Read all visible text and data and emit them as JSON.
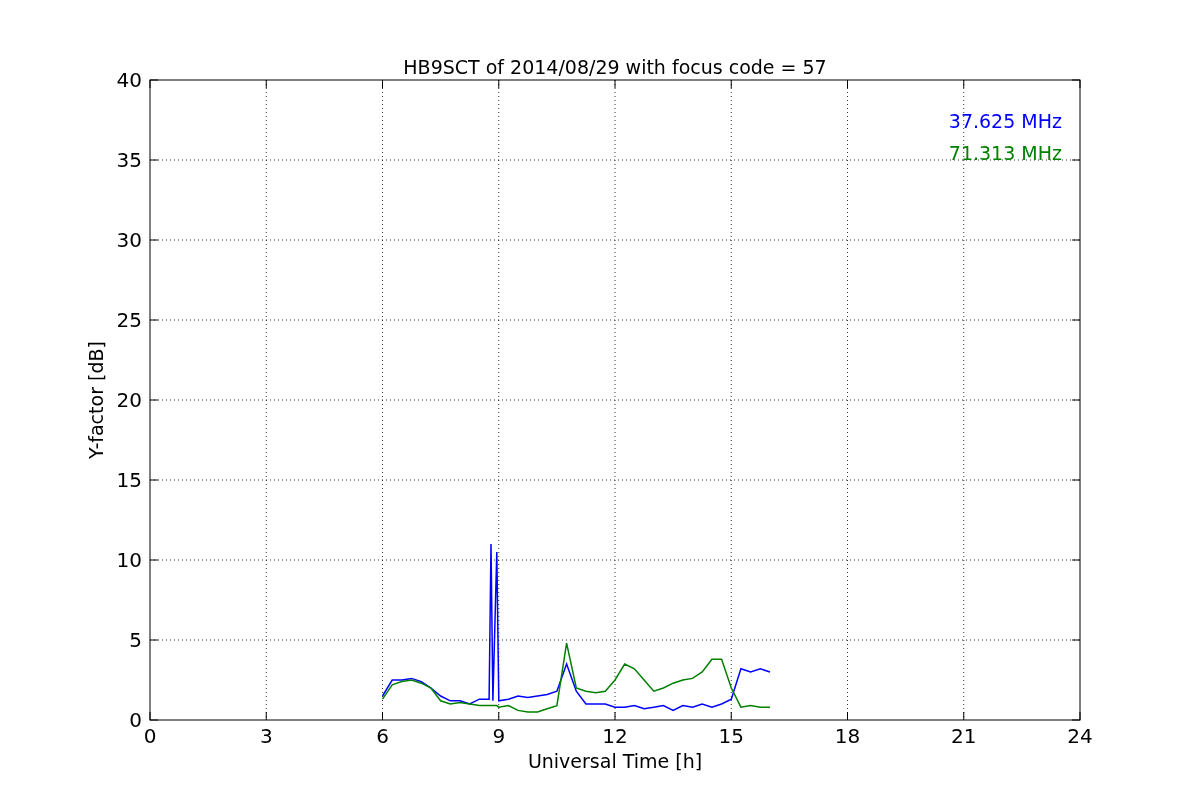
{
  "chart_data": {
    "type": "line",
    "title": "HB9SCT of 2014/08/29 with focus code = 57",
    "xlabel": "Universal Time [h]",
    "ylabel": "Y-factor [dB]",
    "x": [
      6.0,
      6.25,
      6.5,
      6.75,
      7.0,
      7.25,
      7.5,
      7.75,
      8.0,
      8.25,
      8.5,
      8.75,
      8.8,
      8.85,
      8.95,
      9.0,
      9.25,
      9.5,
      9.75,
      10.0,
      10.25,
      10.5,
      10.75,
      11.0,
      11.25,
      11.5,
      11.75,
      12.0,
      12.25,
      12.5,
      12.75,
      13.0,
      13.25,
      13.5,
      13.75,
      14.0,
      14.25,
      14.5,
      14.75,
      15.0,
      15.25,
      15.5,
      15.75,
      16.0
    ],
    "series": [
      {
        "name": "37.625 MHz",
        "color": "#0000ff",
        "values": [
          1.5,
          2.5,
          2.5,
          2.6,
          2.4,
          2.0,
          1.5,
          1.2,
          1.2,
          1.0,
          1.3,
          1.3,
          11.0,
          1.2,
          10.5,
          1.2,
          1.3,
          1.5,
          1.4,
          1.5,
          1.6,
          1.8,
          3.5,
          1.8,
          1.0,
          1.0,
          1.0,
          0.8,
          0.8,
          0.9,
          0.7,
          0.8,
          0.9,
          0.6,
          0.9,
          0.8,
          1.0,
          0.8,
          1.0,
          1.3,
          3.2,
          3.0,
          3.2,
          3.0
        ]
      },
      {
        "name": "71.313 MHz",
        "color": "#008000",
        "values": [
          1.3,
          2.2,
          2.4,
          2.5,
          2.3,
          2.0,
          1.2,
          1.0,
          1.1,
          1.0,
          0.9,
          0.9,
          0.9,
          0.9,
          0.9,
          0.8,
          0.9,
          0.6,
          0.5,
          0.5,
          0.7,
          0.9,
          4.8,
          2.0,
          1.8,
          1.7,
          1.8,
          2.5,
          3.5,
          3.2,
          2.5,
          1.8,
          2.0,
          2.3,
          2.5,
          2.6,
          3.0,
          3.8,
          3.8,
          2.0,
          0.8,
          0.9,
          0.8,
          0.8
        ]
      }
    ],
    "xlim": [
      0,
      24
    ],
    "ylim": [
      0,
      40
    ],
    "xticks": [
      0,
      3,
      6,
      9,
      12,
      15,
      18,
      21,
      24
    ],
    "yticks": [
      0,
      5,
      10,
      15,
      20,
      25,
      30,
      35,
      40
    ],
    "grid": true
  }
}
